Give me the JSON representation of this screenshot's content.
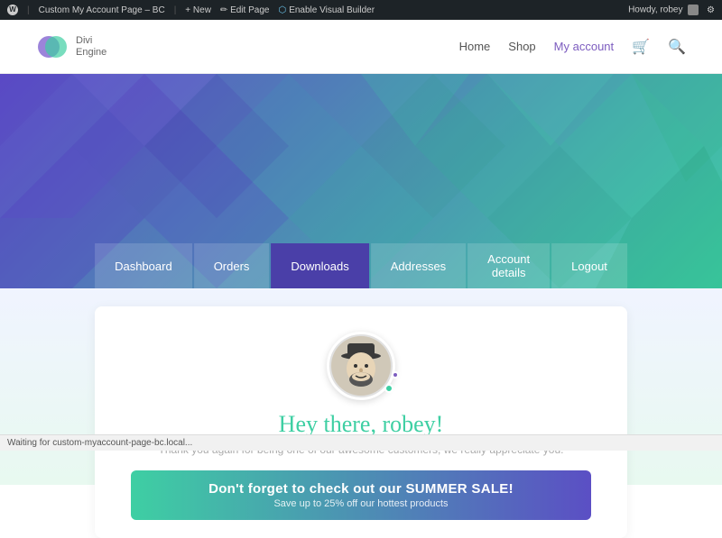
{
  "admin_bar": {
    "wp_label": "W",
    "site_label": "Custom My Account Page – BC",
    "new_label": "+ New",
    "edit_label": "✏ Edit Page",
    "visual_builder_label": "Enable Visual Builder",
    "howdy": "Howdy, robey"
  },
  "header": {
    "logo_name": "Divi",
    "logo_sub": "Engine",
    "nav": {
      "home": "Home",
      "shop": "Shop",
      "my_account": "My account"
    }
  },
  "tabs": [
    {
      "id": "dashboard",
      "label": "Dashboard",
      "active": false
    },
    {
      "id": "orders",
      "label": "Orders",
      "active": false
    },
    {
      "id": "downloads",
      "label": "Downloads",
      "active": true
    },
    {
      "id": "addresses",
      "label": "Addresses",
      "active": false
    },
    {
      "id": "account-details",
      "label": "Account details",
      "active": false
    },
    {
      "id": "logout",
      "label": "Logout",
      "active": false
    }
  ],
  "content": {
    "greeting": "Hey there, robey!",
    "subtext": "Thank you again for being one of our awesome customers, we really appreciate you.",
    "cta_title": "Don't forget to check out our SUMMER SALE!",
    "cta_sub": "Save up to 25% off our hottest products"
  },
  "status_bar": {
    "text": "Waiting for custom-myaccount-page-bc.local..."
  },
  "colors": {
    "teal": "#3ecfa3",
    "purple": "#7c5cbf",
    "dark_purple": "#4a3fa8",
    "tab_active_bg": "#4a3fa8",
    "hero_start": "#5b4fc4",
    "hero_end": "#3ecfa3"
  }
}
